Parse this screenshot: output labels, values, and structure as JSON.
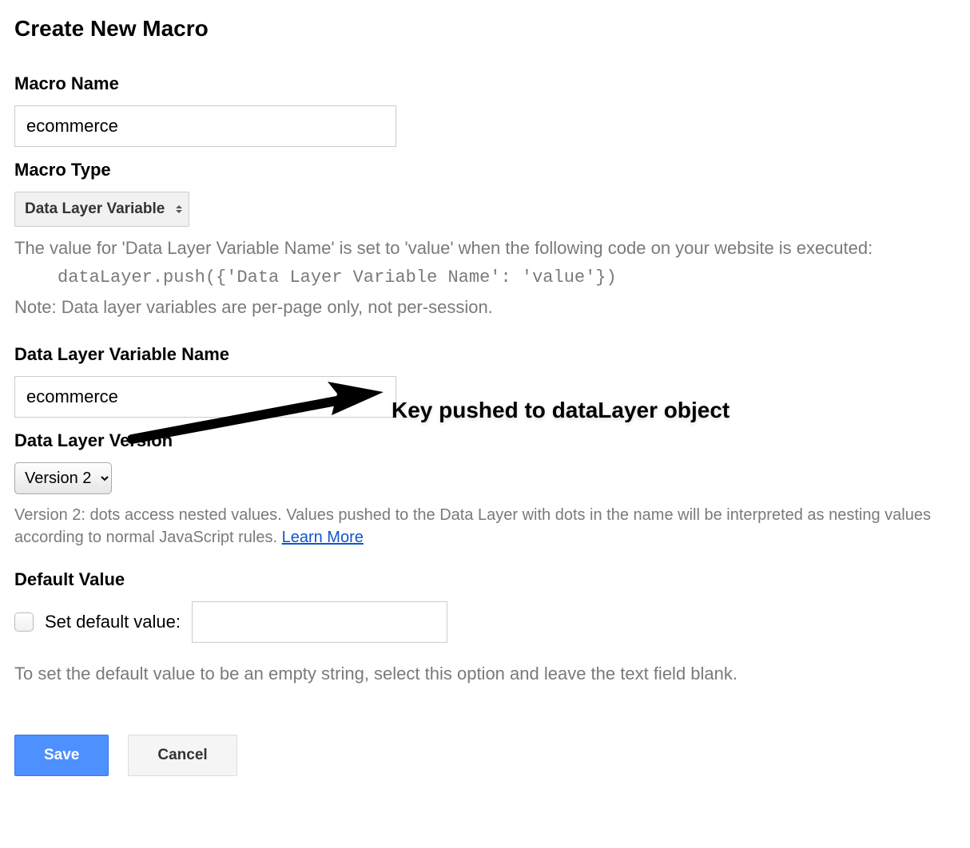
{
  "page_title": "Create New Macro",
  "macro_name": {
    "label": "Macro Name",
    "value": "ecommerce"
  },
  "macro_type": {
    "label": "Macro Type",
    "selected": "Data Layer Variable"
  },
  "type_helper_text": "The value for 'Data Layer Variable Name' is set to 'value' when the following code on your website is executed:",
  "type_code_example": "dataLayer.push({'Data Layer Variable Name': 'value'})",
  "type_note": "Note: Data layer variables are per-page only, not per-session.",
  "variable_name": {
    "label": "Data Layer Variable Name",
    "value": "ecommerce"
  },
  "annotation_text": "Key pushed to dataLayer object",
  "version": {
    "label": "Data Layer Version",
    "selected": "Version 2",
    "desc_prefix": "Version 2: dots access nested values. Values pushed to the Data Layer with dots in the name will be interpreted as nesting values according to normal JavaScript rules. ",
    "learn_more": "Learn More"
  },
  "default_value": {
    "label": "Default Value",
    "checkbox_label": "Set default value:",
    "checked": false,
    "value": "",
    "helper": "To set the default value to be an empty string, select this option and leave the text field blank."
  },
  "buttons": {
    "save": "Save",
    "cancel": "Cancel"
  }
}
